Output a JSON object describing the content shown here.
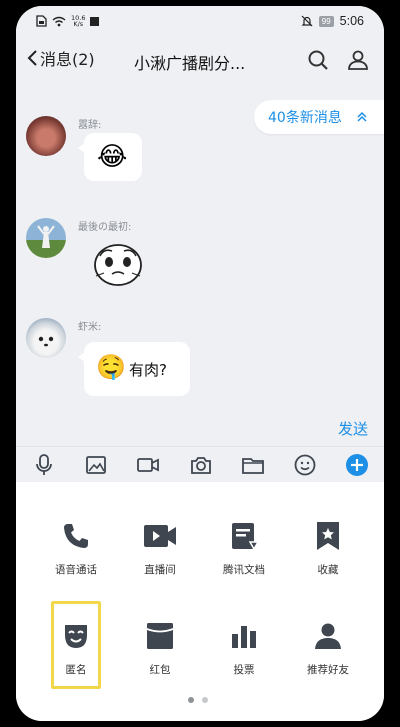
{
  "status_bar": {
    "speed_value": "10.6",
    "speed_unit": "K/s",
    "battery": "99",
    "time": "5:06"
  },
  "navbar": {
    "back_label": "消息(2)",
    "title": "小湫广播剧分..."
  },
  "new_messages": {
    "label": "40条新消息"
  },
  "messages": [
    {
      "sender": "囂辞:",
      "content_type": "emoji",
      "emoji": "😂"
    },
    {
      "sender": "最後の最初:",
      "content_type": "sticker"
    },
    {
      "sender": "虾米:",
      "content_type": "emoji-text",
      "emoji": "🤤",
      "text": "有肉?"
    }
  ],
  "input": {
    "send_label": "发送"
  },
  "toolbar": {
    "icons": [
      "microphone-icon",
      "image-icon",
      "video-icon",
      "camera-icon",
      "folder-icon",
      "emoji-icon",
      "plus-icon"
    ]
  },
  "panel": {
    "row1": [
      {
        "label": "语音通话",
        "icon": "phone-icon"
      },
      {
        "label": "直播间",
        "icon": "live-video-icon"
      },
      {
        "label": "腾讯文档",
        "icon": "document-icon"
      },
      {
        "label": "收藏",
        "icon": "bookmark-icon"
      }
    ],
    "row2": [
      {
        "label": "匿名",
        "icon": "mask-icon"
      },
      {
        "label": "红包",
        "icon": "red-packet-icon"
      },
      {
        "label": "投票",
        "icon": "vote-chart-icon"
      },
      {
        "label": "推荐好友",
        "icon": "recommend-friend-icon"
      }
    ],
    "pages": 2,
    "current_page": 1
  },
  "colors": {
    "accent": "#1d8fe6",
    "background": "#eef0f4",
    "highlight": "#f2d74a",
    "icon_dark": "#3f4650"
  }
}
